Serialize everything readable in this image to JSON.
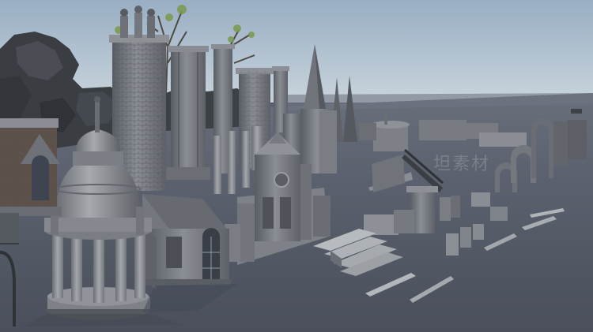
{
  "scene": {
    "title": "",
    "palette": {
      "sky_top": "#9fb4c8",
      "sky_bottom": "#c7d3dc",
      "ground": "#5a606e",
      "ground_dark": "#474c58",
      "stone": "#7b7f86",
      "stone_light": "#9a9ea3",
      "stone_dark": "#4e5259",
      "rock": "#3b3f44",
      "foliage": "#6f8a4a"
    },
    "assets": [
      "rock-cliff",
      "dead-tree",
      "tall-chimney-tower",
      "stone-pillar-cluster",
      "gothic-spire",
      "domed-gazebo",
      "stone-hut",
      "gothic-facade",
      "stone-staircase",
      "railing-segments",
      "broken-columns",
      "distant-fountain",
      "distant-arches",
      "wrought-iron-arch"
    ]
  },
  "watermark": {
    "text": "坦素材"
  }
}
